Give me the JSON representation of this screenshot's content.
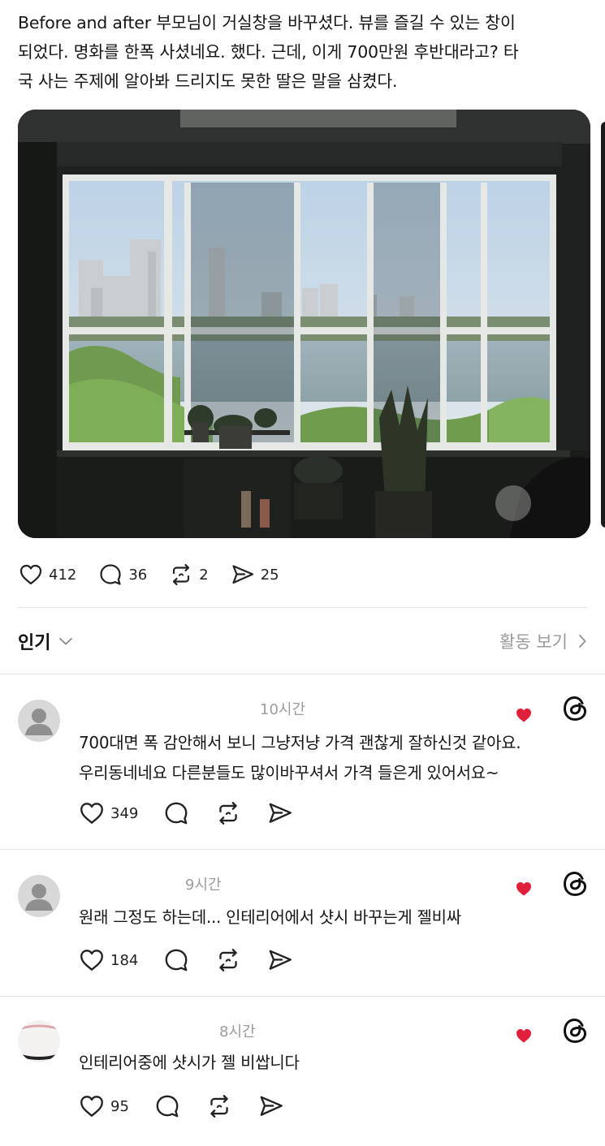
{
  "post": {
    "text_lines": [
      "Before and after 부모님이 거실창을 바꾸셨다. 뷰를 즐길 수 있는 창이",
      "되었다. 명화를 한폭 사셨네요. 했다. 근데, 이게 700만원 후반대라고? 타",
      "국 사는 주제에 알아봐 드리지도 못한 딸은 말을 삼켰다."
    ],
    "stats": {
      "likes": "412",
      "replies": "36",
      "reposts": "2",
      "shares": "25"
    }
  },
  "sort": {
    "label": "인기",
    "activity_link": "활동 보기"
  },
  "comments": [
    {
      "time": "10시간",
      "lines": [
        "700대면 폭 감안해서 보니 그냥저냥 가격 괜찮게 잘하신것 같아요.",
        "우리동네네요 다른분들도 많이바꾸셔서 가격 들은게 있어서요~"
      ],
      "likes": "349"
    },
    {
      "time": "9시간",
      "lines": [
        "원래 그정도 하는데... 인테리어에서 샷시 바꾸는게 젤비싸"
      ],
      "likes": "184"
    },
    {
      "time": "8시간",
      "lines": [
        "인테리어중에 샷시가 젤 비쌉니다"
      ],
      "likes": "95"
    }
  ],
  "colors": {
    "liked_heart": "#e0203a",
    "muted_text": "#9b9b9b"
  },
  "icons": [
    "heart-icon",
    "reply-icon",
    "repost-icon",
    "share-icon",
    "chevron-down-icon",
    "chevron-right-icon",
    "threads-logo-icon",
    "avatar-placeholder-icon"
  ]
}
